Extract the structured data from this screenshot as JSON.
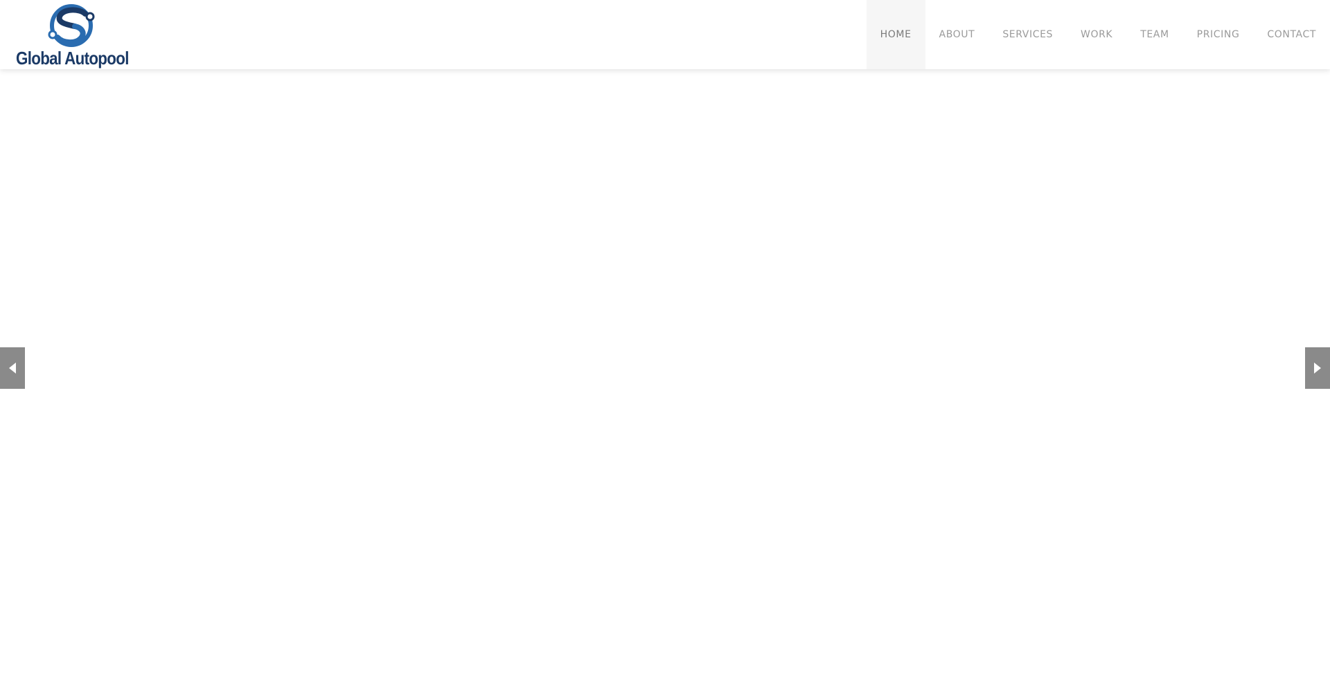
{
  "brand": {
    "name": "Global Autopool",
    "logo_icon": "gear-s-logo-icon",
    "text_color": "#1b3a66",
    "accent_color": "#2a6cb0"
  },
  "nav": {
    "items": [
      {
        "label": "HOME",
        "active": true
      },
      {
        "label": "ABOUT",
        "active": false
      },
      {
        "label": "SERVICES",
        "active": false
      },
      {
        "label": "WORK",
        "active": false
      },
      {
        "label": "TEAM",
        "active": false
      },
      {
        "label": "PRICING",
        "active": false
      },
      {
        "label": "CONTACT",
        "active": false
      }
    ],
    "text_color": "#9a9a9a",
    "active_bg": "#f6f6f6"
  },
  "slider": {
    "prev_icon": "triangle-left-icon",
    "next_icon": "triangle-right-icon",
    "arrow_bg": "#8a8a8a"
  }
}
